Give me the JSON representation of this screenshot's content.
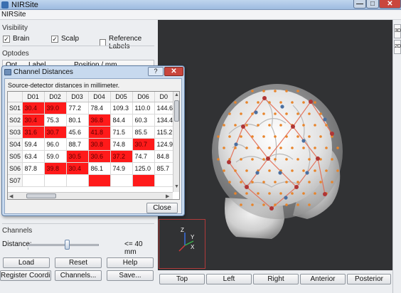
{
  "window": {
    "title": "NIRSite",
    "min_label": "—",
    "max_label": "□",
    "close_label": "✕"
  },
  "menubar": {
    "item": "NIRSite"
  },
  "visibility": {
    "label": "Visibility",
    "brain": {
      "label": "Brain",
      "checked": true
    },
    "scalp": {
      "label": "Scalp",
      "checked": true
    },
    "reference_labels": {
      "label": "Reference Labels",
      "checked": false
    }
  },
  "optodes": {
    "label": "Optodes",
    "col_opt": "Opt",
    "col_label": "Label",
    "col_position": "Position / mm"
  },
  "channels": {
    "label": "Channels",
    "distance_label": "Distance:",
    "distance_value": "<= 40 mm",
    "slider_fraction": 0.55
  },
  "buttons": {
    "load": "Load",
    "reset": "Reset",
    "help": "Help",
    "register": "Register Coordinates...",
    "channels": "Channels...",
    "save": "Save..."
  },
  "view_buttons": {
    "top": "Top",
    "left": "Left",
    "right": "Right",
    "anterior": "Anterior",
    "posterior": "Posterior"
  },
  "side_tabs": [
    "3D",
    "2D"
  ],
  "axes": {
    "z": "Z",
    "y": "Y",
    "x": "X"
  },
  "dialog": {
    "title": "Channel Distances",
    "help_label": "?",
    "close_label": "✕",
    "description": "Source-detector distances in millimeter.",
    "columns": [
      "D01",
      "D02",
      "D03",
      "D04",
      "D05",
      "D06",
      "D0"
    ],
    "rows": [
      {
        "label": "S01",
        "cells": [
          "30.4",
          "39.0",
          "77.2",
          "78.4",
          "109.3",
          "110.0",
          "144.6"
        ],
        "highlight": [
          true,
          true,
          false,
          false,
          false,
          false,
          false
        ]
      },
      {
        "label": "S02",
        "cells": [
          "30.4",
          "75.3",
          "80.1",
          "36.8",
          "84.4",
          "60.3",
          "134.4"
        ],
        "highlight": [
          true,
          false,
          false,
          true,
          false,
          false,
          false
        ]
      },
      {
        "label": "S03",
        "cells": [
          "31.6",
          "30.7",
          "45.6",
          "41.8",
          "71.5",
          "85.5",
          "115.2"
        ],
        "highlight": [
          true,
          true,
          false,
          true,
          false,
          false,
          false
        ]
      },
      {
        "label": "S04",
        "cells": [
          "59.4",
          "96.0",
          "88.7",
          "30.8",
          "74.8",
          "30.7",
          "124.9"
        ],
        "highlight": [
          false,
          false,
          false,
          true,
          false,
          true,
          false
        ]
      },
      {
        "label": "S05",
        "cells": [
          "63.4",
          "59.0",
          "30.5",
          "30.6",
          "37.2",
          "74.7",
          "84.8"
        ],
        "highlight": [
          false,
          false,
          true,
          true,
          true,
          false,
          false
        ]
      },
      {
        "label": "S06",
        "cells": [
          "87.8",
          "39.8",
          "30.4",
          "86.1",
          "74.9",
          "125.0",
          "85.7"
        ],
        "highlight": [
          false,
          true,
          true,
          false,
          false,
          false,
          false
        ]
      },
      {
        "label": "S07",
        "cells": [
          "",
          "",
          "",
          "",
          "",
          "",
          ""
        ],
        "highlight": [
          false,
          false,
          false,
          true,
          false,
          true,
          false
        ]
      }
    ],
    "close_button": "Close"
  },
  "colors": {
    "highlight": "#ff1a1a",
    "viewport_bg": "#313234",
    "source_dot": "#b03535",
    "detector_dot": "#4a6fa0",
    "ref_dot": "#e8842a",
    "channel_line": "#e36a50"
  }
}
